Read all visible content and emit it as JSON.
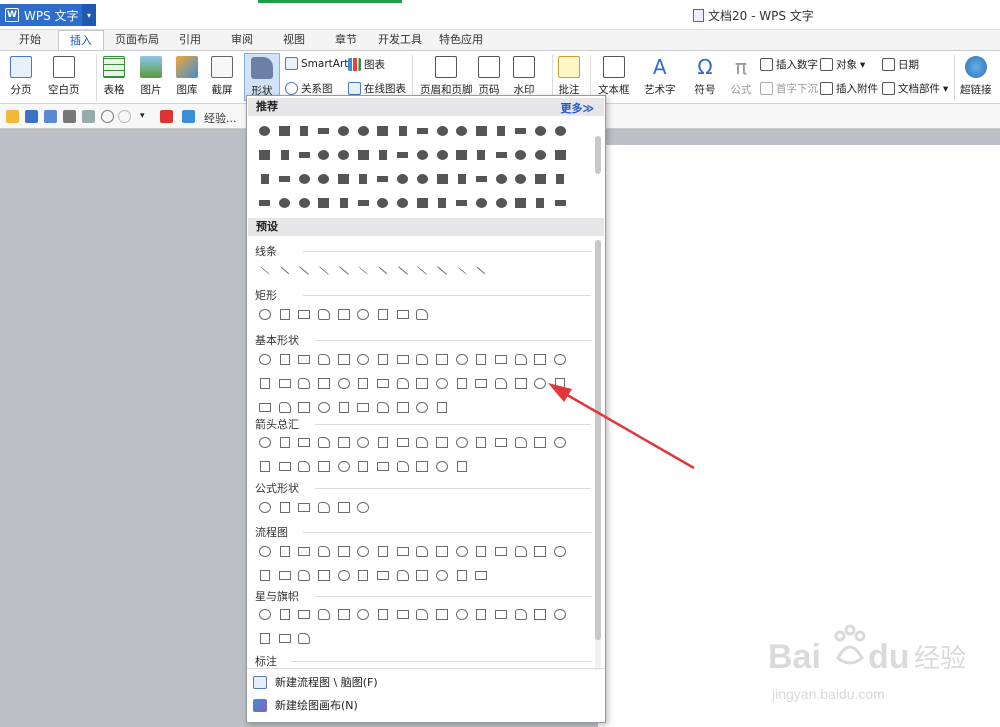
{
  "app": {
    "name": "WPS 文字",
    "doc_title": "文档20 - WPS 文字"
  },
  "tabs": [
    "开始",
    "插入",
    "页面布局",
    "引用",
    "审阅",
    "视图",
    "章节",
    "开发工具",
    "特色应用"
  ],
  "ribbon": {
    "page_break": "分页",
    "blank_page": "空白页",
    "table": "表格",
    "picture": "图片",
    "gallery": "图库",
    "screenshot": "截屏",
    "shapes": "形状",
    "smartart": "SmartArt",
    "chart": "图表",
    "relation": "关系图",
    "online_chart": "在线图表",
    "header_footer": "页眉和页脚",
    "page_number": "页码",
    "watermark": "水印",
    "comment": "批注",
    "textbox": "文本框",
    "wordart": "艺术字",
    "symbol": "符号",
    "formula": "公式",
    "insert_number": "插入数字",
    "drop_cap": "首字下沉",
    "object": "对象",
    "attachment": "插入附件",
    "date": "日期",
    "doc_parts": "文档部件",
    "hyperlink": "超链接"
  },
  "quickbar": {
    "file_label": "经验..."
  },
  "panel": {
    "recommended": "推荐",
    "more": "更多≫",
    "presets": "预设",
    "categories": {
      "lines": "线条",
      "rect": "矩形",
      "basic": "基本形状",
      "arrows": "箭头总汇",
      "equation": "公式形状",
      "flowchart": "流程图",
      "stars": "星与旗帜",
      "callouts": "标注"
    },
    "new_flowchart": "新建流程图 \\ 脑图(F)",
    "new_canvas": "新建绘图画布(N)"
  },
  "watermark": {
    "text": "jingyan.baidu.com"
  },
  "colors": {
    "accent": "#2d6ecc",
    "arrow": "#e0383a"
  }
}
